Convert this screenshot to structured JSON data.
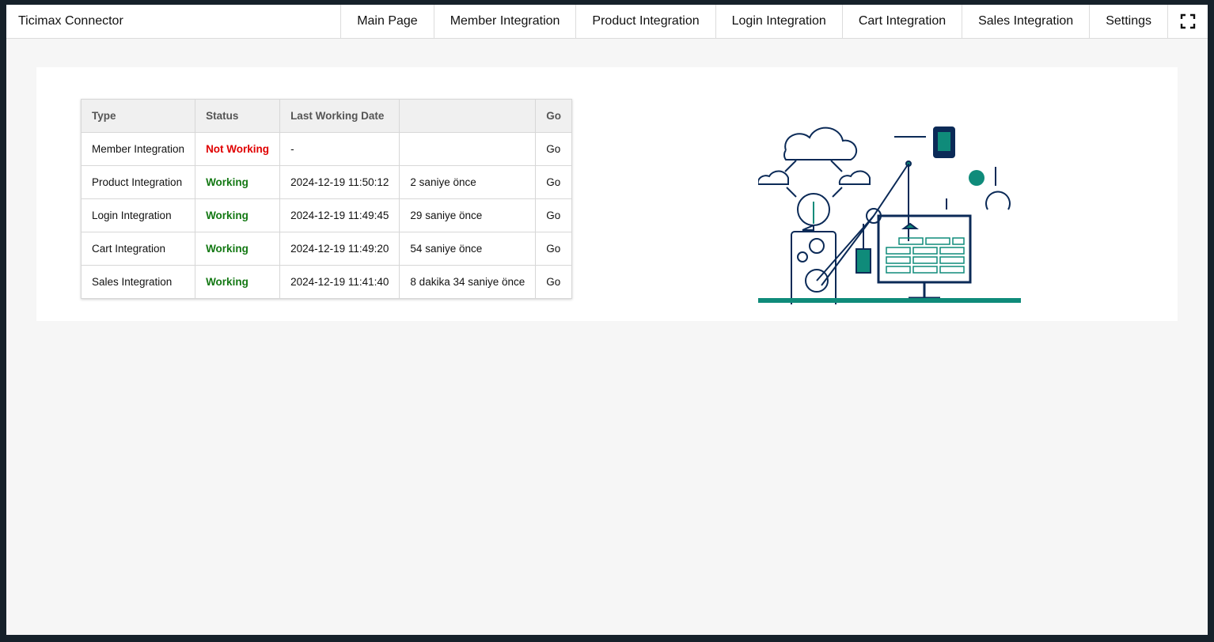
{
  "app": {
    "title": "Ticimax Connector"
  },
  "nav": {
    "items": [
      {
        "label": "Main Page"
      },
      {
        "label": "Member Integration"
      },
      {
        "label": "Product Integration"
      },
      {
        "label": "Login Integration"
      },
      {
        "label": "Cart Integration"
      },
      {
        "label": "Sales Integration"
      },
      {
        "label": "Settings"
      }
    ],
    "fullscreen_icon": "fullscreen-icon"
  },
  "table": {
    "headers": {
      "type": "Type",
      "status": "Status",
      "last": "Last Working Date",
      "ago": "",
      "go": "Go"
    },
    "rows": [
      {
        "type": "Member Integration",
        "status": "Not Working",
        "state": "bad",
        "date": "-",
        "ago": "",
        "go": "Go"
      },
      {
        "type": "Product Integration",
        "status": "Working",
        "state": "ok",
        "date": "2024-12-19 11:50:12",
        "ago": "2 saniye önce",
        "go": "Go"
      },
      {
        "type": "Login Integration",
        "status": "Working",
        "state": "ok",
        "date": "2024-12-19 11:49:45",
        "ago": "29 saniye önce",
        "go": "Go"
      },
      {
        "type": "Cart Integration",
        "status": "Working",
        "state": "ok",
        "date": "2024-12-19 11:49:20",
        "ago": "54 saniye önce",
        "go": "Go"
      },
      {
        "type": "Sales Integration",
        "status": "Working",
        "state": "ok",
        "date": "2024-12-19 11:41:40",
        "ago": "8 dakika 34 saniye önce",
        "go": "Go"
      }
    ]
  },
  "colors": {
    "status_ok": "#137813",
    "status_bad": "#e00000",
    "illustration_navy": "#0b2a57",
    "illustration_teal": "#0f8b7a"
  }
}
